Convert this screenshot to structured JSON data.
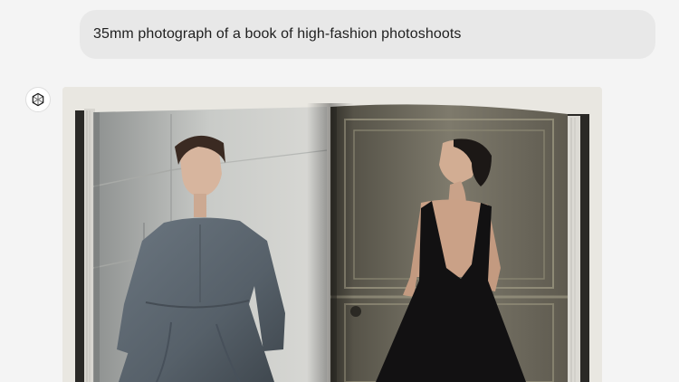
{
  "conversation": {
    "user_message": "35mm photograph of a book of high-fashion photoshoots",
    "assistant": {
      "avatar_icon": "openai-logo-icon",
      "image_description": "Photograph of an open fashion photobook: left page shows a model in a grey wool dress against a stone wall, right page shows a model in a black backless gown before a paneled door"
    }
  },
  "colors": {
    "page_background": "#f4f4f4",
    "bubble_background": "#e8e8e8",
    "text": "#1f1f1f"
  }
}
